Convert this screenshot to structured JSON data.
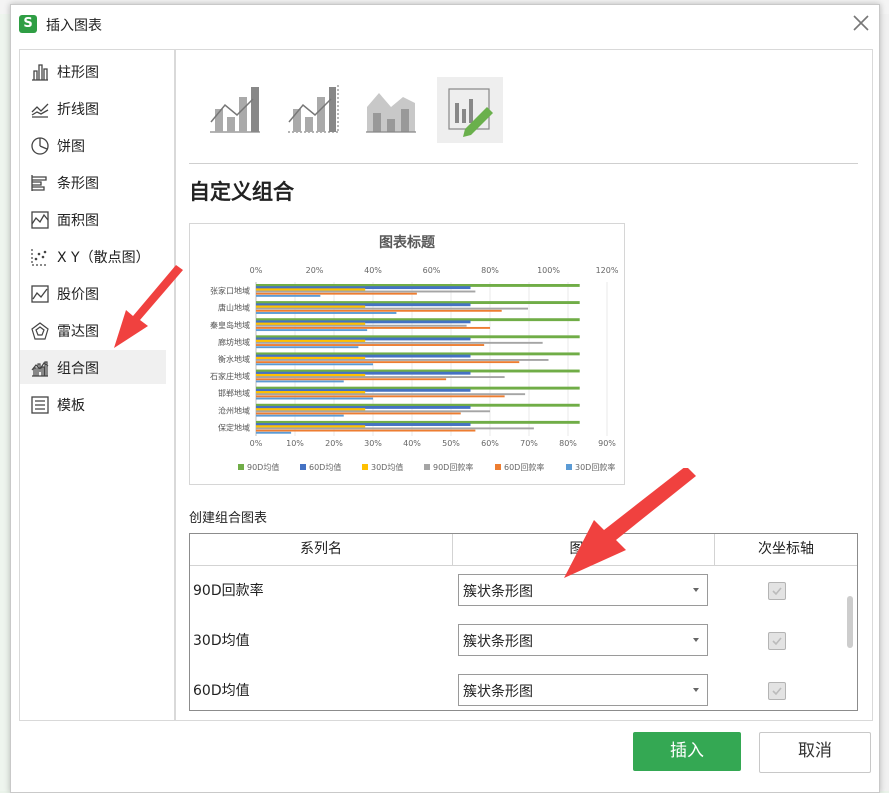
{
  "dialog": {
    "app_logo": "S",
    "title": "插入图表"
  },
  "sidebar": {
    "items": [
      {
        "label": "柱形图",
        "icon": "column-chart-icon"
      },
      {
        "label": "折线图",
        "icon": "line-chart-icon"
      },
      {
        "label": "饼图",
        "icon": "pie-chart-icon"
      },
      {
        "label": "条形图",
        "icon": "bar-chart-icon"
      },
      {
        "label": "面积图",
        "icon": "area-chart-icon"
      },
      {
        "label": "X Y（散点图）",
        "icon": "scatter-chart-icon"
      },
      {
        "label": "股价图",
        "icon": "stock-chart-icon"
      },
      {
        "label": "雷达图",
        "icon": "radar-chart-icon"
      },
      {
        "label": "组合图",
        "icon": "combo-chart-icon"
      },
      {
        "label": "模板",
        "icon": "template-icon"
      }
    ],
    "selected_index": 8
  },
  "main": {
    "subtypes": [
      "combo-column-line-icon",
      "combo-column-line-secondary-axis-icon",
      "combo-area-column-icon",
      "combo-custom-icon"
    ],
    "selected_subtype": 3,
    "section_title": "自定义组合",
    "combo_section_label": "创建组合图表",
    "table": {
      "headers": {
        "series": "系列名",
        "chart_type": "图表",
        "secondary_axis": "次坐标轴"
      },
      "rows": [
        {
          "series": "90D回款率",
          "chart_type": "簇状条形图",
          "secondary_axis": true
        },
        {
          "series": "30D均值",
          "chart_type": "簇状条形图",
          "secondary_axis": true
        },
        {
          "series": "60D均值",
          "chart_type": "簇状条形图",
          "secondary_axis": true
        }
      ]
    }
  },
  "buttons": {
    "insert": "插入",
    "cancel": "取消"
  },
  "colors": {
    "accent_green": "#34a853",
    "arrow_red": "#f0413f"
  },
  "chart_data": {
    "type": "bar",
    "title": "图表标题",
    "categories": [
      "张家口地域",
      "唐山地域",
      "秦皇岛地域",
      "廊坊地域",
      "衡水地域",
      "石家庄地域",
      "邯郸地域",
      "沧州地域",
      "保定地域"
    ],
    "top_axis_ticks": [
      "0%",
      "20%",
      "40%",
      "60%",
      "80%",
      "100%",
      "120%"
    ],
    "bottom_axis_ticks": [
      "0%",
      "10%",
      "20%",
      "30%",
      "40%",
      "50%",
      "60%",
      "70%",
      "80%",
      "90%"
    ],
    "top_axis_max": 1.2,
    "bottom_axis_max": 0.9,
    "legend_position": "bottom",
    "series": [
      {
        "name": "90D均值",
        "color": "#70ad47",
        "axis": "bottom",
        "values": [
          0.83,
          0.83,
          0.83,
          0.83,
          0.83,
          0.83,
          0.83,
          0.83,
          0.83
        ]
      },
      {
        "name": "60D均值",
        "color": "#4472c4",
        "axis": "bottom",
        "values": [
          0.55,
          0.55,
          0.55,
          0.55,
          0.55,
          0.55,
          0.55,
          0.55,
          0.55
        ]
      },
      {
        "name": "30D均值",
        "color": "#ffc000",
        "axis": "bottom",
        "values": [
          0.28,
          0.28,
          0.28,
          0.28,
          0.28,
          0.28,
          0.28,
          0.28,
          0.28
        ]
      },
      {
        "name": "90D回款率",
        "color": "#a5a5a5",
        "axis": "top",
        "values": [
          0.75,
          0.93,
          0.72,
          0.98,
          1.0,
          0.85,
          0.92,
          0.8,
          0.95
        ]
      },
      {
        "name": "60D回款率",
        "color": "#ed7d31",
        "axis": "top",
        "values": [
          0.55,
          0.84,
          0.8,
          0.78,
          0.9,
          0.65,
          0.85,
          0.7,
          0.75
        ]
      },
      {
        "name": "30D回款率",
        "color": "#5b9bd5",
        "axis": "top",
        "values": [
          0.22,
          0.48,
          0.38,
          0.35,
          0.4,
          0.3,
          0.4,
          0.3,
          0.12
        ]
      }
    ]
  }
}
